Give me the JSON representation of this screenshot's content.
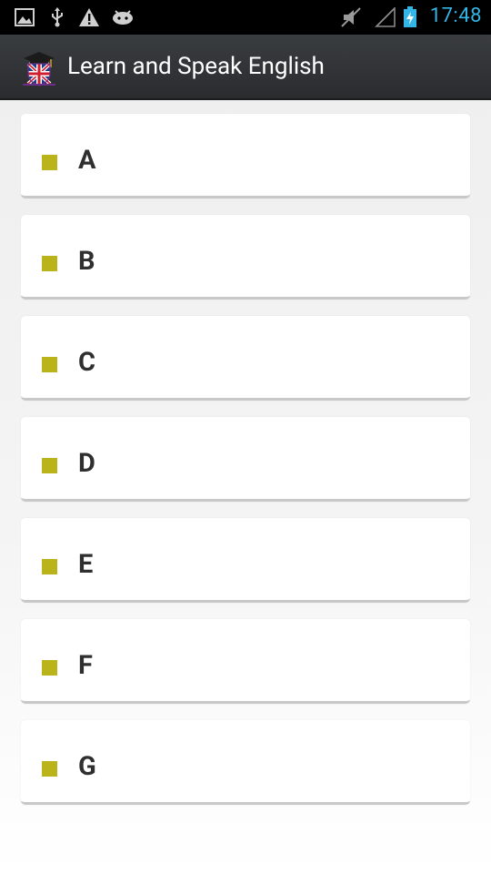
{
  "status_bar": {
    "time": "17:48",
    "icons": [
      "picture-icon",
      "usb-icon",
      "warning-icon",
      "android-debug-icon",
      "mute-icon",
      "signal-icon",
      "battery-charging-icon"
    ],
    "time_color": "#33b5e5"
  },
  "action_bar": {
    "title": "Learn and Speak English",
    "app_icon": "graduation-cap-uk-flag-icon"
  },
  "list": {
    "items": [
      {
        "label": "A"
      },
      {
        "label": "B"
      },
      {
        "label": "C"
      },
      {
        "label": "D"
      },
      {
        "label": "E"
      },
      {
        "label": "F"
      },
      {
        "label": "G"
      }
    ],
    "bullet_color": "#bab31a"
  }
}
